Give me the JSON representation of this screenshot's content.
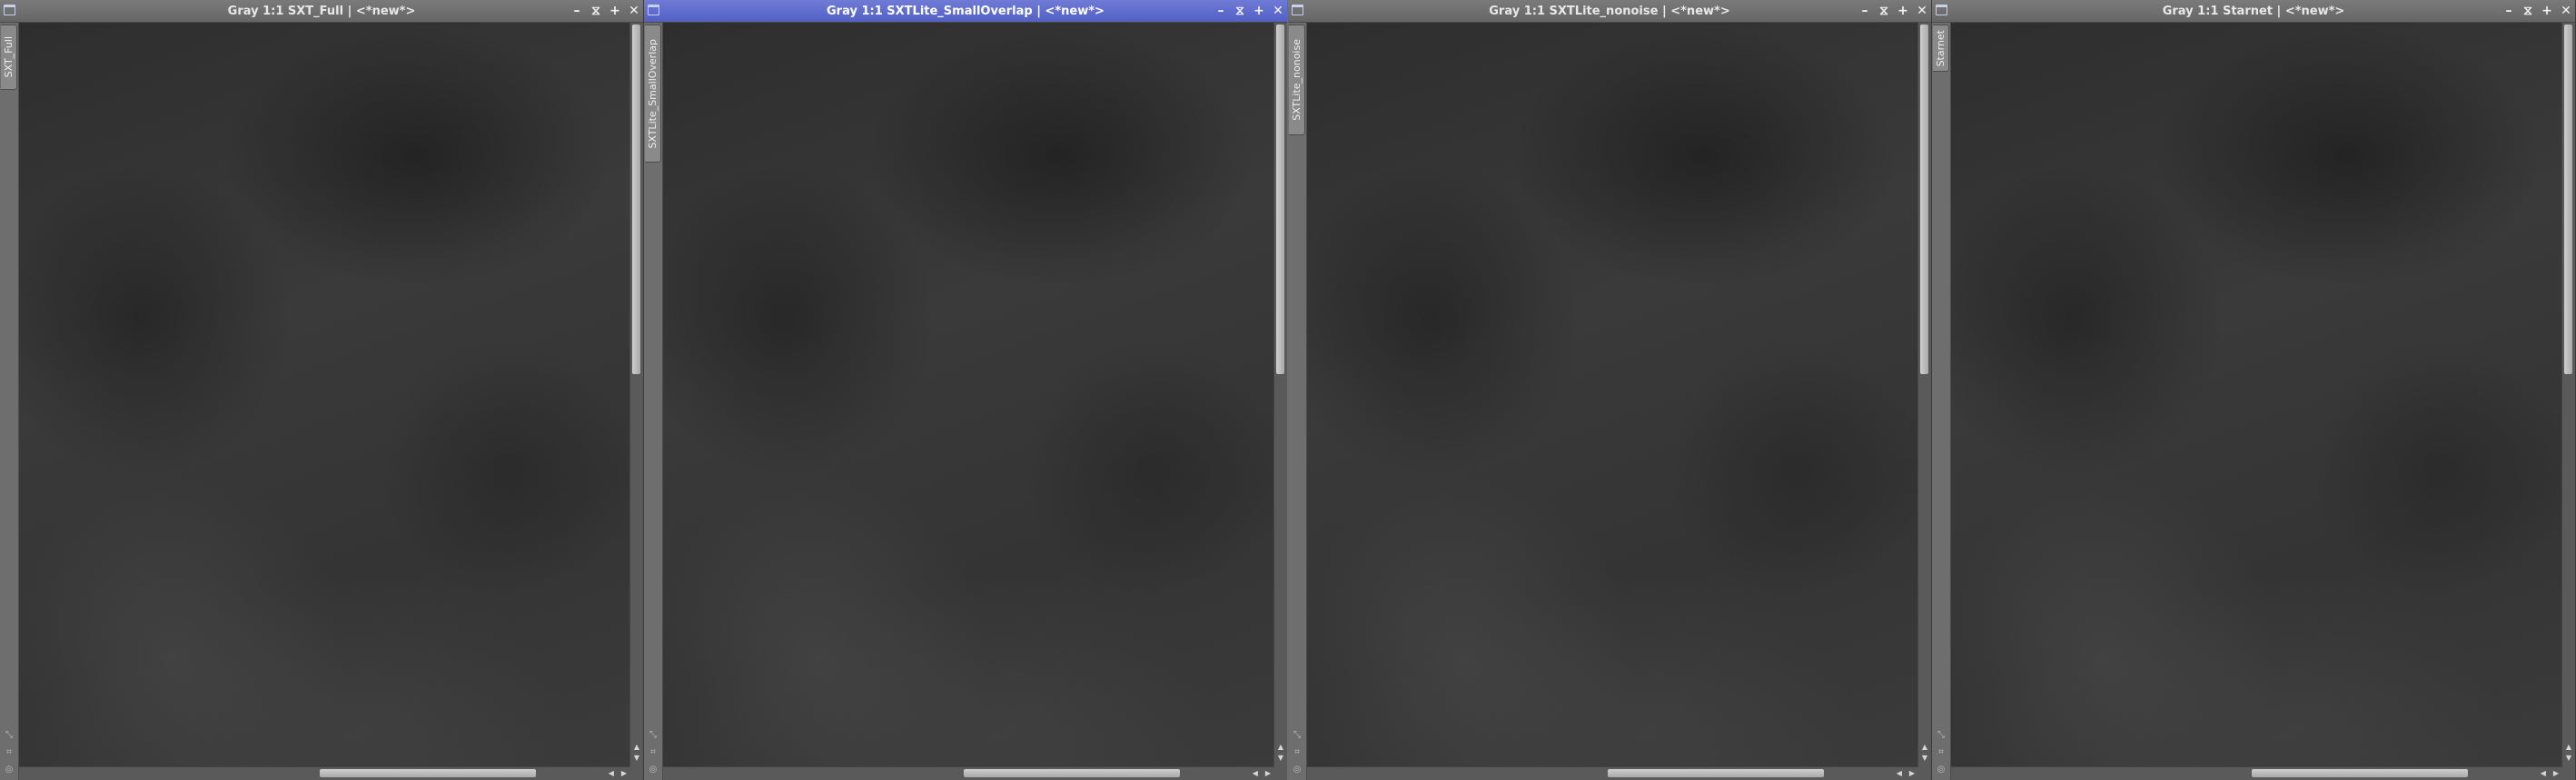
{
  "windows": [
    {
      "title": "Gray 1:1 SXT_Full | <*new*>",
      "tab_label": "SXT_Full",
      "active": false
    },
    {
      "title": "Gray 1:1 SXTLite_SmallOverlap | <*new*>",
      "tab_label": "SXTLite_SmallOverlap",
      "active": true
    },
    {
      "title": "Gray 1:1 SXTLite_nonoise | <*new*>",
      "tab_label": "SXTLite_nonoise",
      "active": false
    },
    {
      "title": "Gray 1:1 Starnet | <*new*>",
      "tab_label": "Starnet",
      "active": false
    }
  ],
  "controls": {
    "minimize": "–",
    "shade": "⧖",
    "maximize": "+",
    "close": "✕"
  },
  "colors": {
    "active_title": "#5a66c8",
    "inactive_title": "#6e6e6e",
    "image_bg": "#363636"
  }
}
